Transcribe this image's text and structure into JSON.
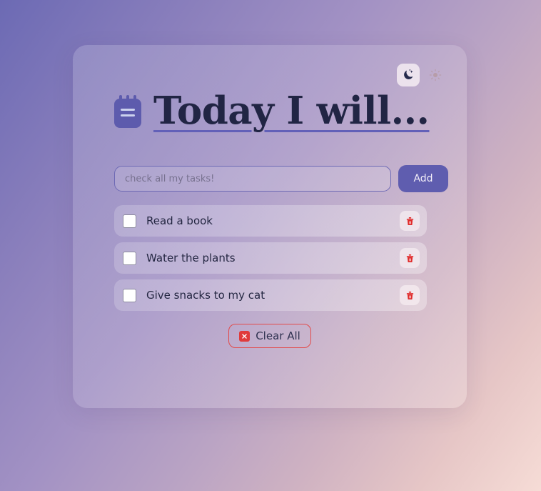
{
  "app": {
    "title": "Today I will...",
    "brand_icon": "notepad-icon"
  },
  "theme": {
    "dark_icon": "moon-star-icon",
    "light_icon": "sun-icon",
    "active": "dark"
  },
  "compose": {
    "placeholder": "check all my tasks!",
    "value": "",
    "add_label": "Add"
  },
  "tasks": [
    {
      "label": "Read a book",
      "checked": false,
      "delete_icon": "trash-icon"
    },
    {
      "label": "Water the plants",
      "checked": false,
      "delete_icon": "trash-icon"
    },
    {
      "label": "Give snacks to my cat",
      "checked": false,
      "delete_icon": "trash-icon"
    }
  ],
  "clear": {
    "label": "Clear All",
    "icon": "x-square-icon"
  },
  "colors": {
    "accent_purple": "#5f5daf",
    "title_navy": "#212544",
    "danger_red": "#e03b3b",
    "bg_gradient_start": "#6c6ab4",
    "bg_gradient_end": "#f6dcd6"
  }
}
